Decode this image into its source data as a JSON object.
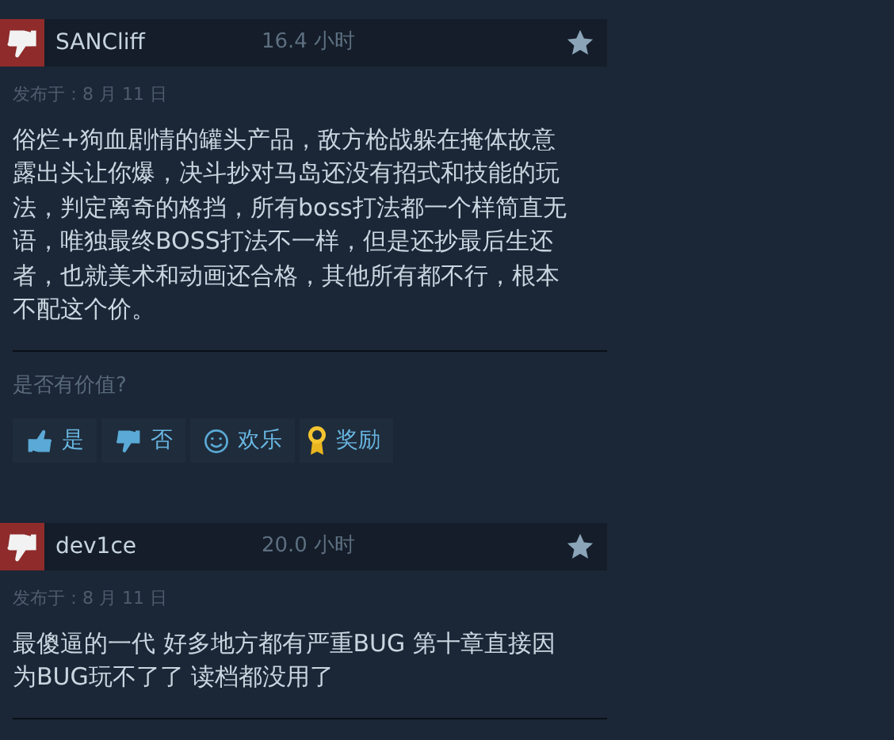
{
  "reviews": [
    {
      "author": "SANCliff",
      "recommended": false,
      "hours": "16.4 小时",
      "posted": "发布于：8 月 11 日",
      "text": "俗烂+狗血剧情的罐头产品，敌方枪战躲在掩体故意露出头让你爆，决斗抄对马岛还没有招式和技能的玩法，判定离奇的格挡，所有boss打法都一个样简直无语，唯独最终BOSS打法不一样，但是还抄最后生还者，也就美术和动画还合格，其他所有都不行，根本不配这个价。",
      "helpful_prompt": "是否有价值?",
      "actions": [
        {
          "kind": "yes",
          "label": "是"
        },
        {
          "kind": "no",
          "label": "否"
        },
        {
          "kind": "funny",
          "label": "欢乐"
        },
        {
          "kind": "award",
          "label": "奖励"
        }
      ]
    },
    {
      "author": "dev1ce",
      "recommended": false,
      "hours": "20.0 小时",
      "posted": "发布于：8 月 11 日",
      "text": "最傻逼的一代 好多地方都有严重BUG 第十章直接因为BUG玩不了了 读档都没用了"
    }
  ]
}
